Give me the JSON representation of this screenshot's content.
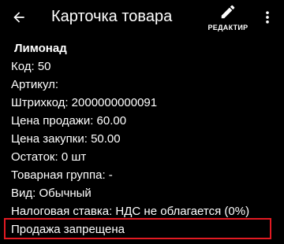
{
  "header": {
    "title": "Карточка товара",
    "edit_label": "РЕДАКТИР"
  },
  "product": {
    "name": "Лимонад",
    "code": "Код: 50",
    "article": "Артикул:",
    "barcode": "Штрихкод: 2000000000091",
    "sale_price": "Цена продажи: 60.00",
    "purchase_price": "Цена закупки: 50.00",
    "stock": "Остаток: 0 шт",
    "group": "Товарная группа: -",
    "kind": "Вид: Обычный",
    "tax_rate": "Налоговая ставка: НДС не облагается (0%)",
    "sale_status": "Продажа запрещена"
  },
  "colors": {
    "background": "#000000",
    "text": "#ffffff",
    "highlight_border": "#e21a22"
  },
  "icons": [
    "arrow-back-icon",
    "pencil-icon",
    "more-vert-icon"
  ]
}
